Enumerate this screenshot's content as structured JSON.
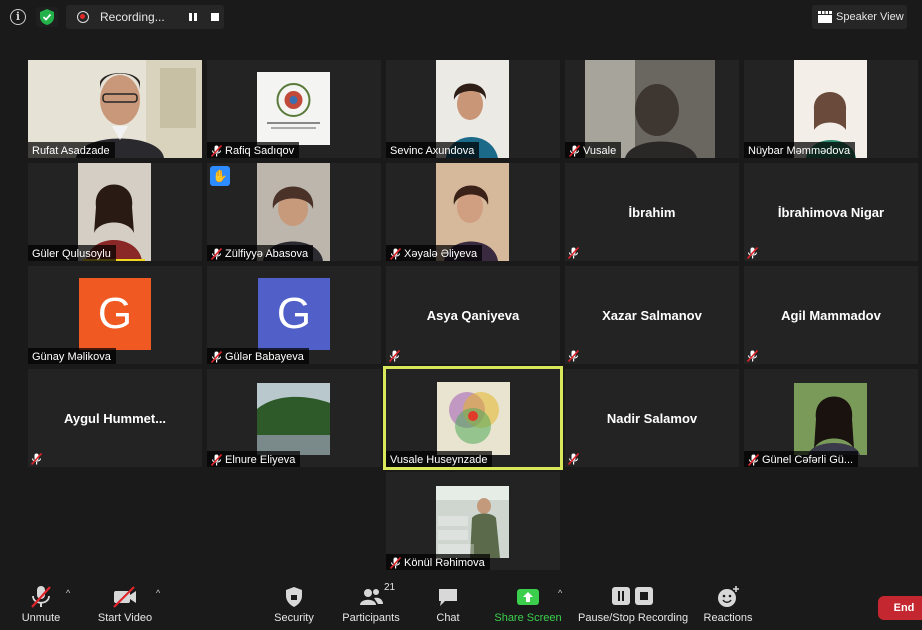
{
  "topbar": {
    "recording_label": "Recording...",
    "speaker_view_label": "Speaker View"
  },
  "participants": [
    {
      "name": "Rufat Asadzade"
    },
    {
      "name": "Rafiq Sadıqov"
    },
    {
      "name": "Sevinc Axundova"
    },
    {
      "name": "Vusale"
    },
    {
      "name": "Nüybar Məmmədova"
    },
    {
      "name": "Güler Qulusoylu"
    },
    {
      "name": "Zülfiyyə Abasova"
    },
    {
      "name": "Xəyalə Əliyeva"
    },
    {
      "name": "İbrahim"
    },
    {
      "name": "İbrahimova Nigar"
    },
    {
      "name": "Günay Məlikova",
      "initial": "G",
      "color": "#f05a22"
    },
    {
      "name": "Gülər Babayeva",
      "initial": "G",
      "color": "#5060c8"
    },
    {
      "name": "Asya Qaniyeva"
    },
    {
      "name": "Xazar Salmanov"
    },
    {
      "name": "Agil Mammadov"
    },
    {
      "name": "Aygul  Hummet..."
    },
    {
      "name": "Elnure Eliyeva"
    },
    {
      "name": "Vusale Huseynzade"
    },
    {
      "name": "Nadir Salamov"
    },
    {
      "name": "Günel Cəfərli Gü..."
    },
    {
      "name": "Könül Rəhimova"
    }
  ],
  "toolbar": {
    "unmute": "Unmute",
    "start_video": "Start Video",
    "security": "Security",
    "participants": "Participants",
    "participants_count": "21",
    "chat": "Chat",
    "share_screen": "Share Screen",
    "pause_stop_recording": "Pause/Stop Recording",
    "reactions": "Reactions",
    "end": "End"
  },
  "colors": {
    "active_speaker_border": "#d8e85a",
    "share_green": "#3ccf4e",
    "end_red": "#c4272f",
    "raise_hand_blue": "#2d8cff"
  }
}
